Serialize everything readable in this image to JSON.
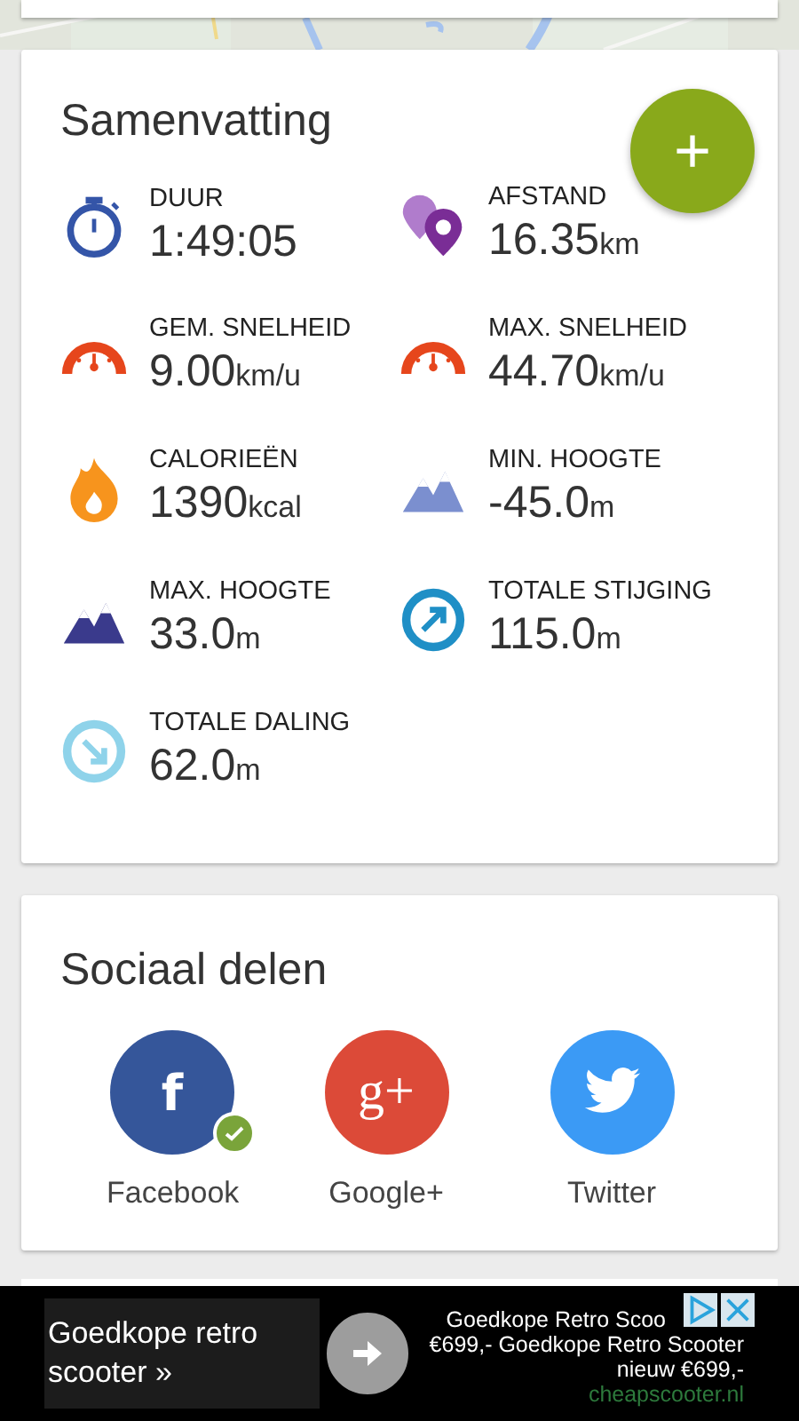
{
  "summary": {
    "title": "Samenvatting",
    "add_button": "+",
    "stats": [
      {
        "kind": "stopwatch",
        "label": "DUUR",
        "value": "1:49:05"
      },
      {
        "kind": "location",
        "label": "AFSTAND",
        "value": "16.35",
        "unit": "km"
      },
      {
        "kind": "speedometer",
        "label": "GEM. SNELHEID",
        "value": "9.00",
        "unit": "km/u"
      },
      {
        "kind": "speedometer",
        "label": "MAX. SNELHEID",
        "value": "44.70",
        "unit": "km/u"
      },
      {
        "kind": "flame",
        "label": "CALORIEËN",
        "value": "1390",
        "unit": "kcal"
      },
      {
        "kind": "hills",
        "label": "MIN. HOOGTE",
        "value": "-45.0",
        "unit": "m"
      },
      {
        "kind": "peaks",
        "label": "MAX. HOOGTE",
        "value": "33.0",
        "unit": "m"
      },
      {
        "kind": "ascent",
        "label": "TOTALE STIJGING",
        "value": "115.0",
        "unit": "m"
      },
      {
        "kind": "descent",
        "label": "TOTALE DALING",
        "value": "62.0",
        "unit": "m"
      }
    ]
  },
  "social": {
    "title": "Sociaal delen",
    "networks": [
      {
        "kind": "facebook",
        "glyph": "f",
        "label": "Facebook",
        "connected": true
      },
      {
        "kind": "googleplus",
        "glyph": "g+",
        "label": "Google+",
        "connected": false
      },
      {
        "kind": "twitter",
        "label": "Twitter",
        "connected": false
      }
    ]
  },
  "ad": {
    "headline": "Goedkope retro scooter »",
    "lines": [
      "Goedkope Retro Scoo",
      "€699,- Goedkope Retro Scooter",
      "nieuw €699,-"
    ],
    "domain": "cheapscooter.nl"
  }
}
